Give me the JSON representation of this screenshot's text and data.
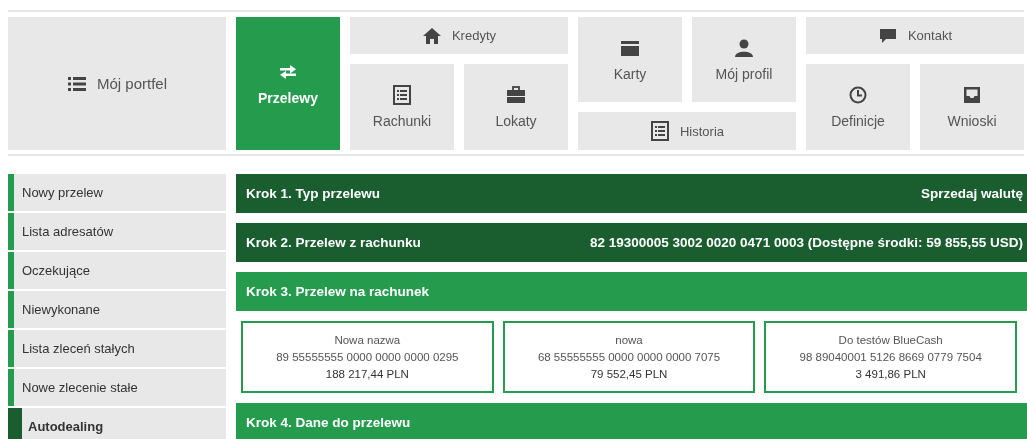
{
  "nav": [
    {
      "label": "Mój portfel",
      "selected": false
    },
    {
      "label": "Przelewy",
      "selected": true
    },
    {
      "label": "Kredyty",
      "selected": false
    },
    {
      "label": "Rachunki",
      "selected": false
    },
    {
      "label": "Lokaty",
      "selected": false
    },
    {
      "label": "Karty",
      "selected": false
    },
    {
      "label": "Mój profil",
      "selected": false
    },
    {
      "label": "Historia",
      "selected": false
    },
    {
      "label": "Kontakt",
      "selected": false
    },
    {
      "label": "Definicje",
      "selected": false
    },
    {
      "label": "Wnioski",
      "selected": false
    }
  ],
  "sidebar": {
    "items": [
      {
        "label": "Nowy przelew",
        "selected": false
      },
      {
        "label": "Lista adresatów",
        "selected": false
      },
      {
        "label": "Oczekujące",
        "selected": false
      },
      {
        "label": "Niewykonane",
        "selected": false
      },
      {
        "label": "Lista zleceń stałych",
        "selected": false
      },
      {
        "label": "Nowe zlecenie stałe",
        "selected": false
      },
      {
        "label": "Autodealing",
        "selected": true
      }
    ]
  },
  "steps": [
    {
      "title": "Krok 1. Typ przelewu",
      "value": "Sprzedaj walutę",
      "done": true
    },
    {
      "title": "Krok 2. Przelew z rachunku",
      "value": "82 19300005 3002 0020 0471 0003 (Dostępne środki: 59 855,55 USD)",
      "done": true
    },
    {
      "title": "Krok 3. Przelew na rachunek",
      "done": false,
      "accounts": [
        {
          "name": "Nowa nazwa",
          "number": "89 55555555 0000 0000 0000 0295",
          "balance": "188 217,44 PLN"
        },
        {
          "name": "nowa",
          "number": "68 55555555 0000 0000 0000 7075",
          "balance": "79 552,45 PLN"
        },
        {
          "name": "Do testów BlueCash",
          "number": "98 89040001 5126 8669 0779 7504",
          "balance": "3 491,86 PLN"
        }
      ]
    },
    {
      "title": "Krok 4. Dane do przelewu",
      "done": false
    }
  ]
}
